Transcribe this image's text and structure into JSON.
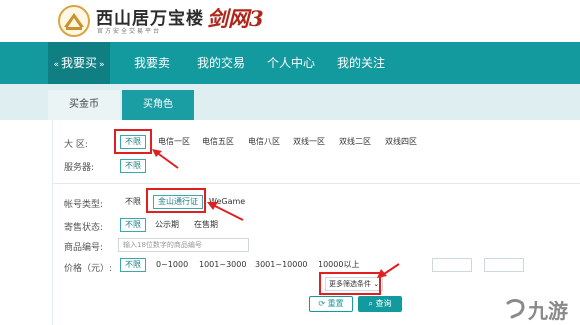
{
  "header": {
    "site_title": "西山居万宝楼",
    "site_subtitle": "官方安全交易平台",
    "game_logo": "剑网3"
  },
  "nav": {
    "items": [
      {
        "label": "我要买",
        "active": true
      },
      {
        "label": "我要卖"
      },
      {
        "label": "我的交易"
      },
      {
        "label": "个人中心"
      },
      {
        "label": "我的关注"
      }
    ]
  },
  "tabs": [
    {
      "label": "买金币"
    },
    {
      "label": "买角色",
      "active": true
    }
  ],
  "filters": {
    "region": {
      "label": "大 区:",
      "options": [
        "不限",
        "电信一区",
        "电信五区",
        "电信八区",
        "双线一区",
        "双线二区",
        "双线四区"
      ]
    },
    "server": {
      "label": "服务器:",
      "options": [
        "不限"
      ]
    },
    "account_type": {
      "label": "帐号类型:",
      "options": [
        "不限",
        "金山通行证",
        "WeGame"
      ]
    },
    "sale_status": {
      "label": "寄售状态:",
      "options": [
        "不限",
        "公示期",
        "在售期"
      ]
    },
    "item_id": {
      "label": "商品编号:",
      "placeholder": "输入18位数字的商品编号"
    },
    "price": {
      "label": "价格（元）:",
      "options": [
        "不限",
        "0~1000",
        "1001~3000",
        "3001~10000",
        "10000以上"
      ]
    }
  },
  "actions": {
    "more_filters": "更多筛选条件",
    "reset": "重置",
    "search": "查询"
  },
  "watermark": {
    "text": "九游"
  },
  "colors": {
    "brand_teal": "#139a9f",
    "highlight_red": "#e02020"
  }
}
